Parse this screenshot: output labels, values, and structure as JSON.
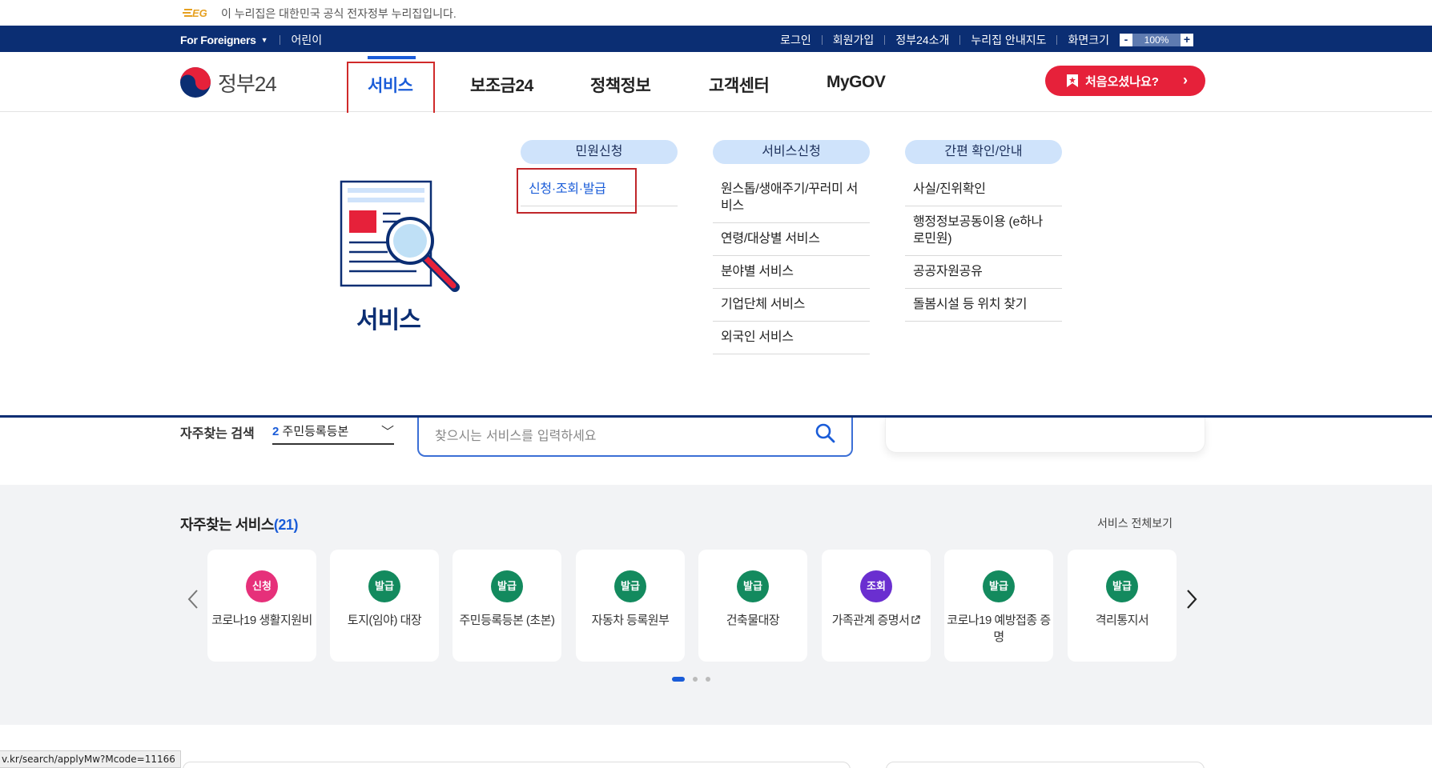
{
  "gov_notice": "이 누리집은 대한민국 공식 전자정부 누리집입니다.",
  "util_left": [
    "For Foreigners",
    "어린이"
  ],
  "util_right": [
    "로그인",
    "회원가입",
    "정부24소개",
    "누리집 안내지도",
    "화면크기"
  ],
  "zoom": {
    "minus": "-",
    "value": "100%",
    "plus": "+"
  },
  "logo_text": "정부24",
  "nav": [
    "서비스",
    "보조금24",
    "정책정보",
    "고객센터",
    "MyGOV"
  ],
  "first_visit": "처음오셨나요?",
  "mega": {
    "title": "서비스",
    "columns": [
      {
        "heading": "민원신청",
        "links": [
          "신청·조회·발급"
        ]
      },
      {
        "heading": "서비스신청",
        "links": [
          "원스톱/생애주기/꾸러미 서비스",
          "연령/대상별 서비스",
          "분야별 서비스",
          "기업단체 서비스",
          "외국인 서비스"
        ]
      },
      {
        "heading": "간편 확인/안내",
        "links": [
          "사실/진위확인",
          "행정정보공동이용 (e하나로민원)",
          "공공자원공유",
          "돌봄시설 등 위치 찾기"
        ]
      }
    ]
  },
  "search": {
    "fav_label": "자주찾는 검색",
    "fav_num": "2",
    "fav_value": "주민등록등본",
    "placeholder": "찾으시는 서비스를 입력하세요"
  },
  "freq": {
    "title": "자주찾는 서비스",
    "count": "(21)",
    "all_link": "서비스 전체보기",
    "items": [
      {
        "badge": "신청",
        "color": "#e6307a",
        "label": "코로나19 생활지원비"
      },
      {
        "badge": "발급",
        "color": "#138a5e",
        "label": "토지(임야) 대장"
      },
      {
        "badge": "발급",
        "color": "#138a5e",
        "label": "주민등록등본 (초본)"
      },
      {
        "badge": "발급",
        "color": "#138a5e",
        "label": "자동차 등록원부"
      },
      {
        "badge": "발급",
        "color": "#138a5e",
        "label": "건축물대장"
      },
      {
        "badge": "조회",
        "color": "#6a2fd0",
        "label": "가족관계 증명서"
      },
      {
        "badge": "발급",
        "color": "#138a5e",
        "label": "코로나19 예방접종 증명"
      },
      {
        "badge": "발급",
        "color": "#138a5e",
        "label": "격리통지서"
      }
    ]
  },
  "status_url": "v.kr/search/applyMw?Mcode=11166"
}
